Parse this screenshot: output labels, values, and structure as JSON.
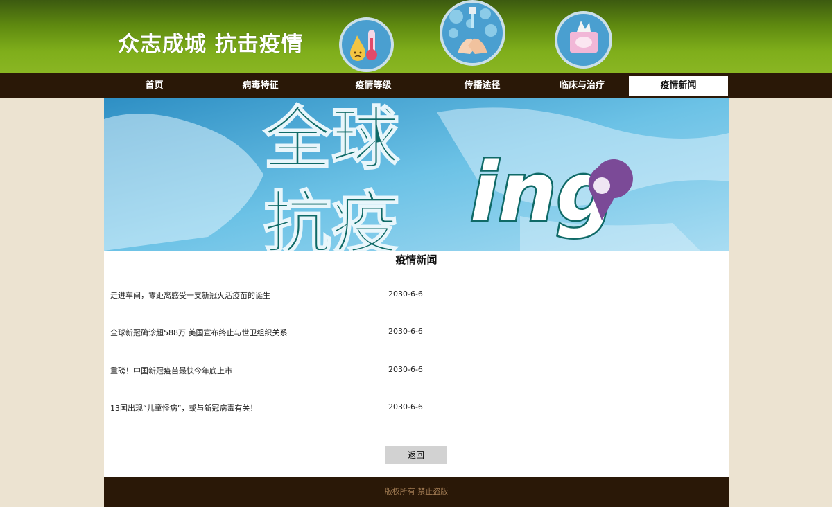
{
  "header": {
    "slogan": "众志成城 抗击疫情",
    "badges": [
      "thermometer-icon",
      "hand-washing-icon",
      "tissue-box-icon"
    ]
  },
  "nav": {
    "items": [
      "首页",
      "病毒特征",
      "疫情等级",
      "传播途径",
      "临床与治疗",
      "疫情新闻"
    ],
    "active": "疫情新闻"
  },
  "banner": {
    "line1": "全球",
    "line2": "抗疫",
    "suffix": "ing",
    "colors": {
      "text": "#0f6a67",
      "bg": "#6cbde0",
      "pin": "#7b4a97"
    }
  },
  "news": {
    "title": "疫情新闻",
    "items": [
      {
        "title": "走进车间，零距离感受一支新冠灭活疫苗的诞生",
        "date": "2030-6-6"
      },
      {
        "title": "全球新冠确诊超588万 美国宣布终止与世卫组织关系",
        "date": "2030-6-6"
      },
      {
        "title": "重磅！中国新冠疫苗最快今年底上市",
        "date": "2030-6-6"
      },
      {
        "title": "13国出现“儿童怪病”，或与新冠病毒有关！",
        "date": "2030-6-6"
      }
    ],
    "back_label": "返回"
  },
  "footer": {
    "text": "版权所有 禁止盗版"
  }
}
